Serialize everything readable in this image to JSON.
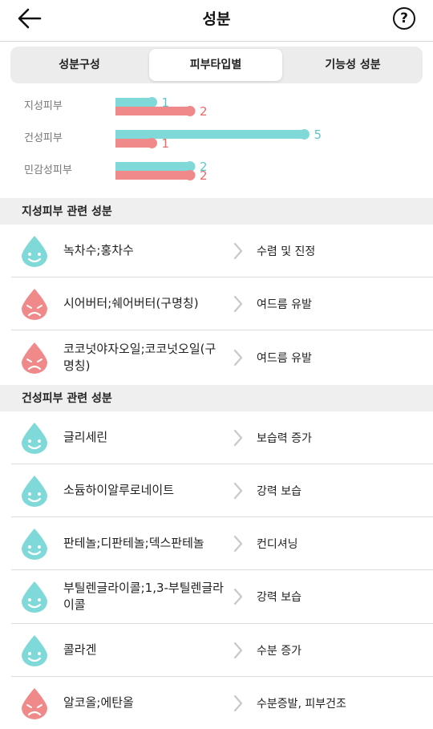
{
  "header": {
    "title": "성분",
    "help_label": "?"
  },
  "tabs": [
    {
      "label": "성분구성",
      "active": false
    },
    {
      "label": "피부타입별",
      "active": true
    },
    {
      "label": "기능성 성분",
      "active": false
    }
  ],
  "chart_data": {
    "type": "bar",
    "categories": [
      "지성피부",
      "건성피부",
      "민감성피부"
    ],
    "series": [
      {
        "name": "good",
        "color": "#7fd9d9",
        "values": [
          1,
          5,
          2
        ]
      },
      {
        "name": "bad",
        "color": "#f08a8a",
        "values": [
          2,
          1,
          2
        ]
      }
    ]
  },
  "colors": {
    "good": "#7fd9d9",
    "bad": "#f08a8a"
  },
  "sections": [
    {
      "title": "지성피부 관련 성분",
      "items": [
        {
          "icon": "happy-drop-icon",
          "type": "good",
          "name": "녹차수;홍차수",
          "effect": "수렴 및 진정"
        },
        {
          "icon": "sad-drop-icon",
          "type": "bad",
          "name": "시어버터;쉐어버터(구명칭)",
          "effect": "여드름 유발"
        },
        {
          "icon": "sad-drop-icon",
          "type": "bad",
          "name": "코코넛야자오일;코코넛오일(구명칭)",
          "effect": "여드름 유발"
        }
      ]
    },
    {
      "title": "건성피부 관련 성분",
      "items": [
        {
          "icon": "happy-drop-icon",
          "type": "good",
          "name": "글리세린",
          "effect": "보습력 증가"
        },
        {
          "icon": "happy-drop-icon",
          "type": "good",
          "name": "소듐하이알루로네이트",
          "effect": "강력 보습"
        },
        {
          "icon": "happy-drop-icon",
          "type": "good",
          "name": "판테놀;디판테놀;덱스판테놀",
          "effect": "컨디셔닝"
        },
        {
          "icon": "happy-drop-icon",
          "type": "good",
          "name": "부틸렌글라이콜;1,3-부틸렌글라이콜",
          "effect": "강력 보습"
        },
        {
          "icon": "happy-drop-icon",
          "type": "good",
          "name": "콜라겐",
          "effect": "수분 증가"
        },
        {
          "icon": "sad-drop-icon",
          "type": "bad",
          "name": "알코올;에탄올",
          "effect": "수분증발, 피부건조"
        }
      ]
    }
  ]
}
